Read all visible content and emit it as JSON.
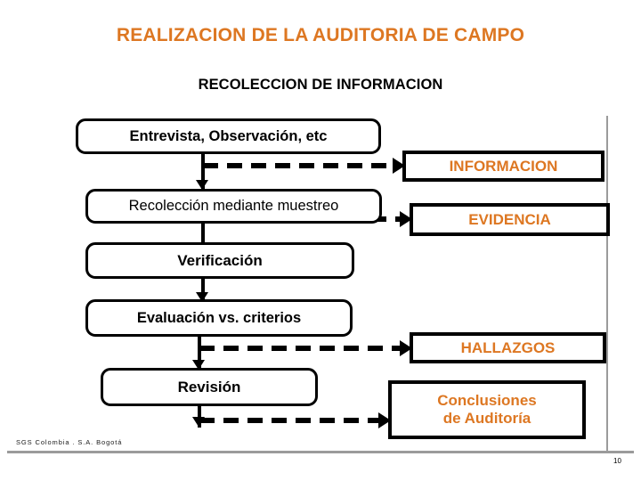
{
  "slide": {
    "title": "REALIZACION DE LA AUDITORIA DE CAMPO",
    "subtitle": "RECOLECCION DE INFORMACION",
    "accent_color": "#DD7722",
    "text_color": "#000000",
    "background": "#ffffff"
  },
  "process_steps": [
    {
      "id": "entrevista",
      "label": "Entrevista, Observación, etc"
    },
    {
      "id": "recoleccion",
      "label": "Recolección mediante muestreo"
    },
    {
      "id": "verificacion",
      "label": "Verificación"
    },
    {
      "id": "evaluacion",
      "label": "Evaluación vs. criterios"
    },
    {
      "id": "revision",
      "label": "Revisión"
    }
  ],
  "outputs": [
    {
      "id": "informacion",
      "label": "INFORMACION"
    },
    {
      "id": "evidencia",
      "label": "EVIDENCIA"
    },
    {
      "id": "hallazgos",
      "label": "HALLAZGOS"
    },
    {
      "id": "conclusiones",
      "label": "Conclusiones\nde Auditoría",
      "line1": "Conclusiones",
      "line2": "de Auditoría"
    }
  ],
  "footer": {
    "company": "SGS Colombia . S.A.  Bogotá",
    "page_number": "10"
  }
}
